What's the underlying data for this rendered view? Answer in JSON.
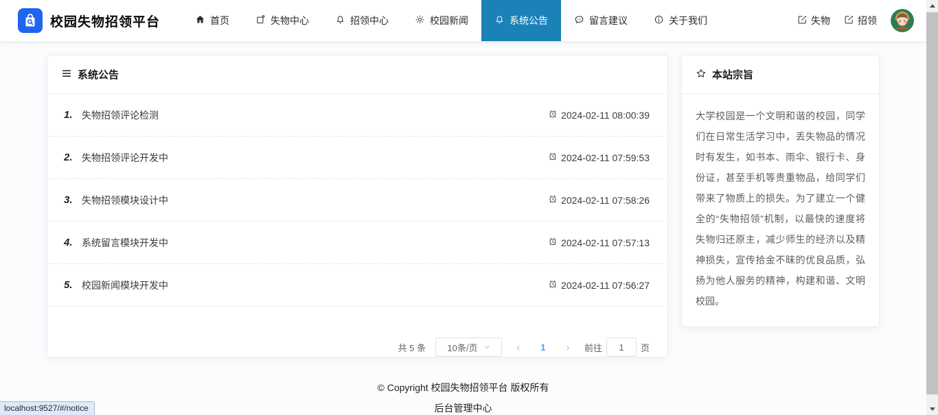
{
  "colors": {
    "nav_active_bg": "#1b82b8",
    "logo_bg": "#2065f0",
    "page_link_blue": "#409eff"
  },
  "header": {
    "brand": "校园失物招领平台",
    "nav": {
      "items": [
        {
          "label": "首页",
          "icon": "home-icon",
          "active": false
        },
        {
          "label": "失物中心",
          "icon": "copy-document-icon",
          "active": false
        },
        {
          "label": "招领中心",
          "icon": "bell-icon",
          "active": false
        },
        {
          "label": "校园新闻",
          "icon": "sun-icon",
          "active": false
        },
        {
          "label": "系统公告",
          "icon": "bell-icon",
          "active": true
        },
        {
          "label": "留言建议",
          "icon": "chat-icon",
          "active": false
        },
        {
          "label": "关于我们",
          "icon": "info-icon",
          "active": false
        }
      ]
    },
    "actions": [
      {
        "label": "失物",
        "icon": "edit-icon"
      },
      {
        "label": "招领",
        "icon": "edit-icon"
      }
    ]
  },
  "notices": {
    "title": "系统公告",
    "title_icon": "menu-icon",
    "items": [
      {
        "num": "1.",
        "title": "失物招领评论检测",
        "time": "2024-02-11 08:00:39"
      },
      {
        "num": "2.",
        "title": "失物招领评论开发中",
        "time": "2024-02-11 07:59:53"
      },
      {
        "num": "3.",
        "title": "失物招领模块设计中",
        "time": "2024-02-11 07:58:26"
      },
      {
        "num": "4.",
        "title": "系统留言模块开发中",
        "time": "2024-02-11 07:57:13"
      },
      {
        "num": "5.",
        "title": "校园新闻模块开发中",
        "time": "2024-02-11 07:56:27"
      }
    ]
  },
  "pagination": {
    "total": "共 5 条",
    "page_size": "10条/页",
    "prev": "‹",
    "current_page": "1",
    "next": "›",
    "jumper_prefix": "前往",
    "jumper_value": "1",
    "jumper_suffix": "页"
  },
  "aside": {
    "title": "本站宗旨",
    "title_icon": "star-icon",
    "content": "大学校园是一个文明和谐的校园，同学们在日常生活学习中，丢失物品的情况时有发生，如书本、雨伞、银行卡、身份证，甚至手机等贵重物品，给同学们带来了物质上的损失。为了建立一个健全的“失物招领”机制，以最快的速度将失物归还原主，减少师生的经济以及精神损失，宣传拾金不昧的优良品质，弘扬为他人服务的精神，构建和谐、文明校园。"
  },
  "footer": {
    "copyright": "© Copyright 校园失物招领平台 版权所有",
    "admin_link": "后台管理中心"
  },
  "browser": {
    "status_url": "localhost:9527/#/notice"
  }
}
